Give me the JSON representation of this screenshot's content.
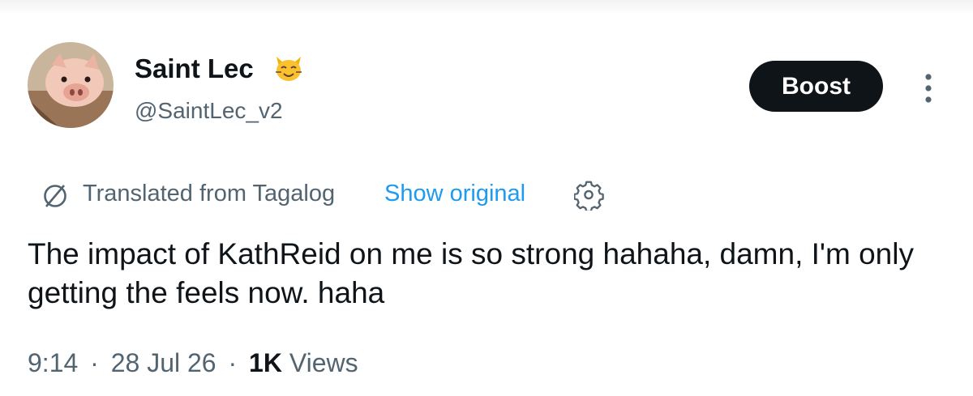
{
  "author": {
    "display_name": "Saint Lec",
    "badge_icon": "cat-emoji-icon",
    "handle": "@SaintLec_v2",
    "avatar_icon": "piglet-avatar"
  },
  "actions": {
    "boost_label": "Boost",
    "more_icon": "vertical-ellipsis-icon"
  },
  "translation": {
    "icon": "globe-icon",
    "translated_label": "Translated from Tagalog",
    "show_original_label": "Show original",
    "settings_icon": "gear-icon"
  },
  "tweet": {
    "text": "The impact of KathReid on me is so strong hahaha, damn, I'm only getting the feels now. haha"
  },
  "meta": {
    "time": "9:14",
    "separator": "·",
    "date": "28 Jul 26",
    "views_count": "1K",
    "views_label": "Views"
  },
  "colors": {
    "text_primary": "#0f1419",
    "text_secondary": "#536471",
    "link": "#1d9bf0",
    "button_bg": "#0f1419",
    "button_text": "#ffffff"
  }
}
